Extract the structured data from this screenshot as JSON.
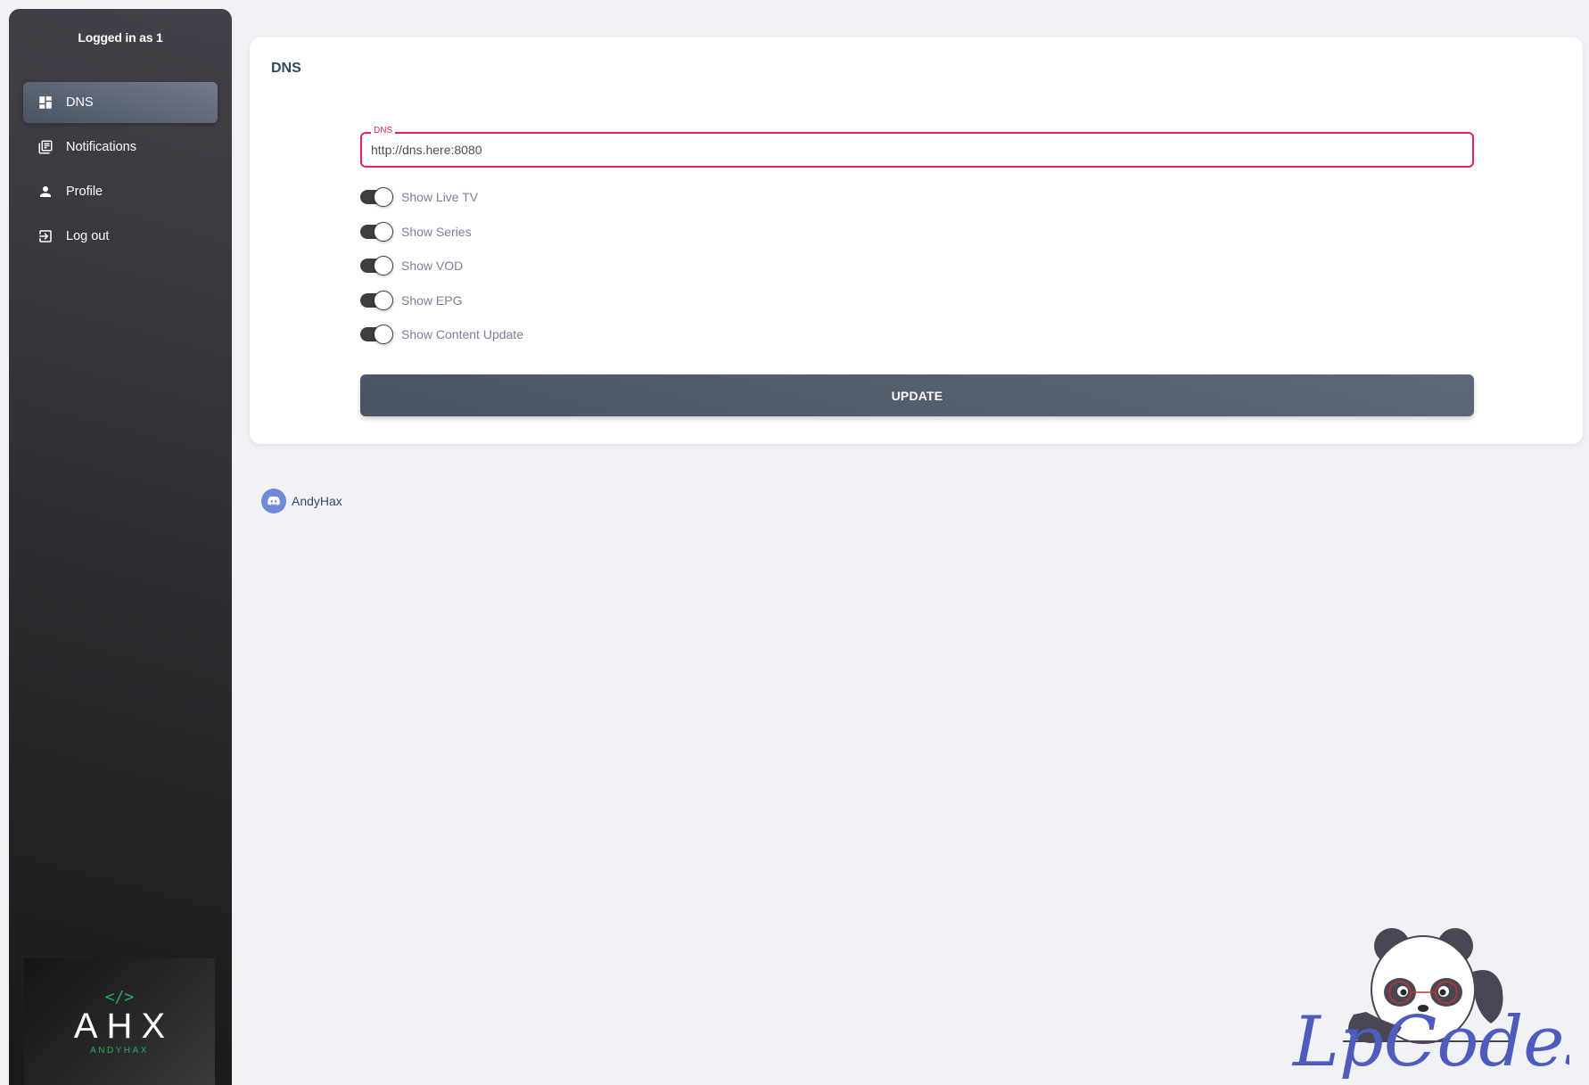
{
  "sidebar": {
    "brand": "Logged in as 1",
    "items": [
      {
        "label": "DNS",
        "icon": "dashboard-icon",
        "active": true
      },
      {
        "label": "Notifications",
        "icon": "notifications-icon",
        "active": false
      },
      {
        "label": "Profile",
        "icon": "person-icon",
        "active": false
      },
      {
        "label": "Log out",
        "icon": "logout-icon",
        "active": false
      }
    ],
    "logo": {
      "code": "</>",
      "main": "AHX",
      "sub": "ANDYHAX"
    }
  },
  "card": {
    "title": "DNS",
    "dns_field": {
      "label": "DNS",
      "value": "http://dns.here:8080"
    },
    "toggles": [
      {
        "label": "Show Live TV",
        "on": true
      },
      {
        "label": "Show Series",
        "on": true
      },
      {
        "label": "Show VOD",
        "on": true
      },
      {
        "label": "Show EPG",
        "on": true
      },
      {
        "label": "Show Content Update",
        "on": true
      }
    ],
    "update_label": "UPDATE"
  },
  "credit": {
    "icon": "discord-icon",
    "name": "AndyHax"
  },
  "watermark": {
    "text": "LpCodes"
  },
  "colors": {
    "accent": "#e91e63",
    "sidebar_top": "#42424a",
    "sidebar_bottom": "#191919",
    "logo_green": "#1fae63",
    "watermark_blue": "#4f5bbd"
  }
}
